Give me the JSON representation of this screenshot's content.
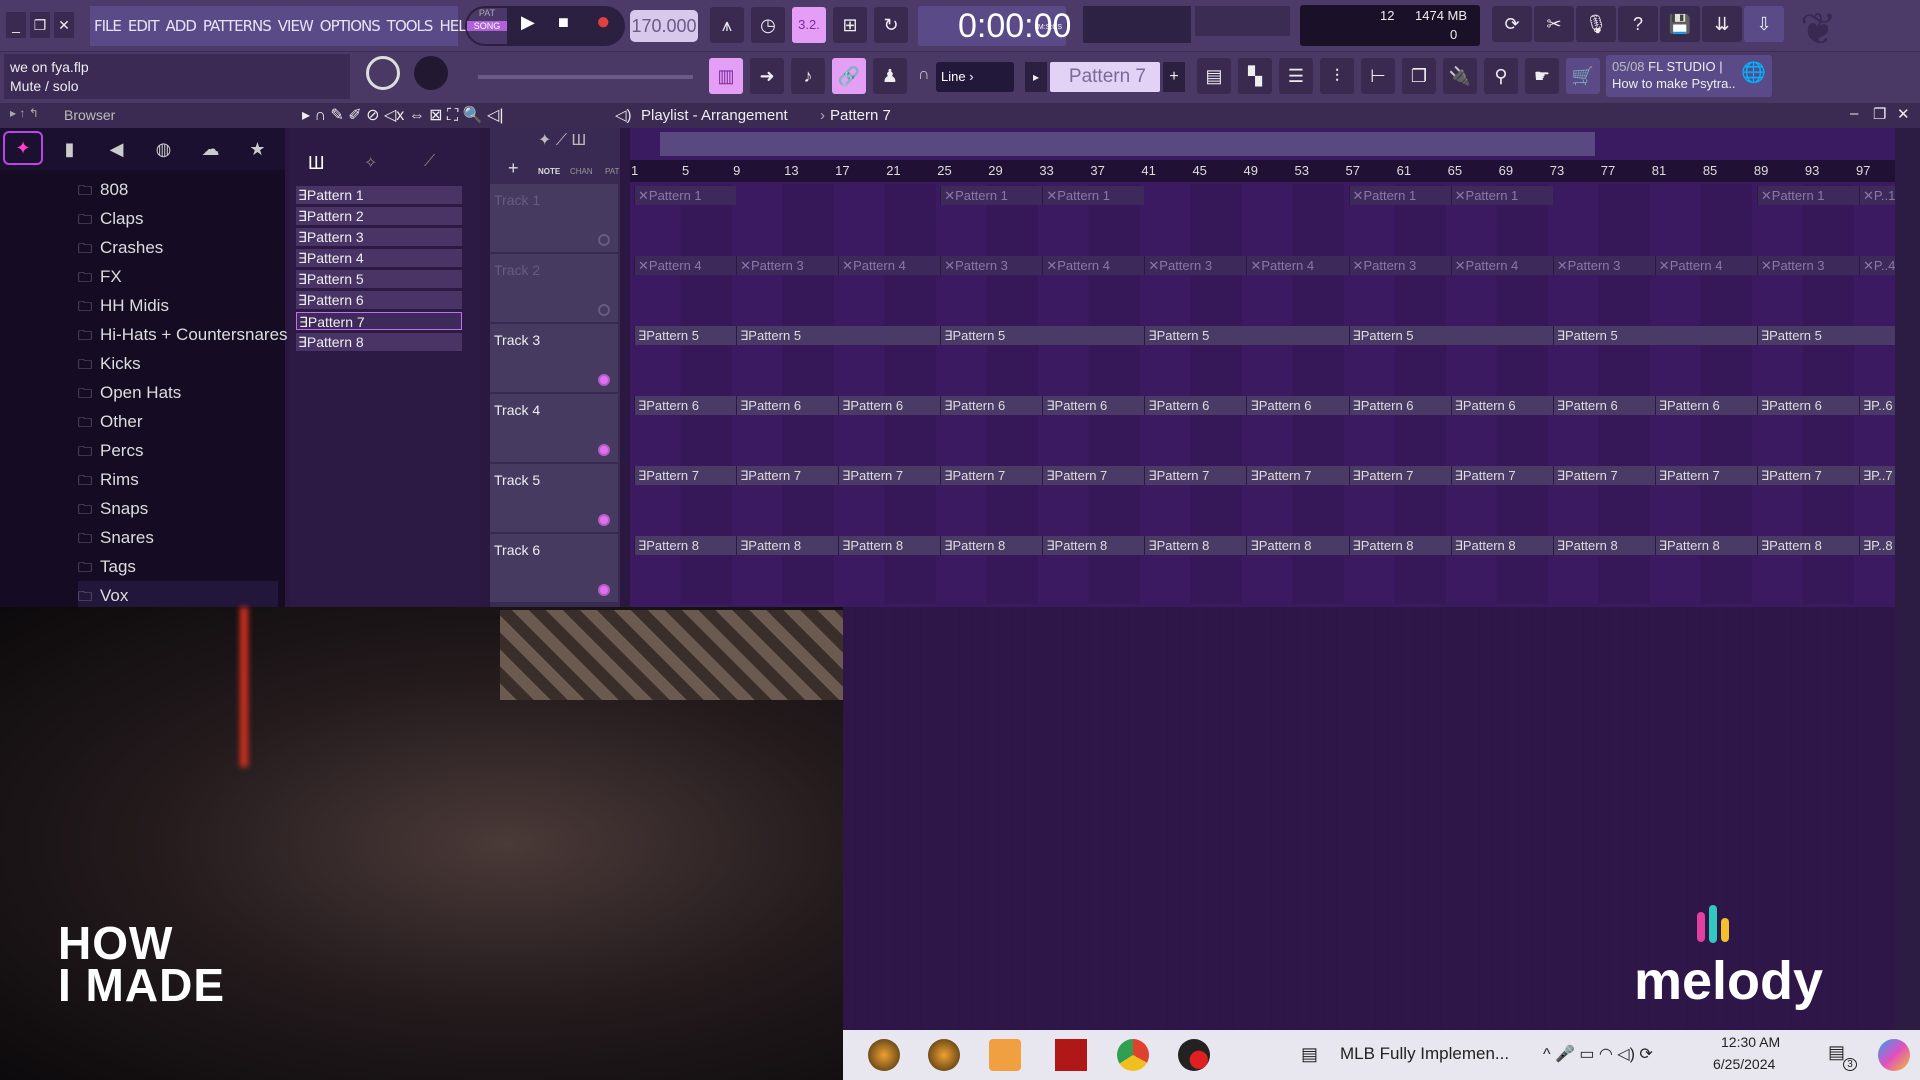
{
  "menu": {
    "items": [
      "FILE",
      "EDIT",
      "ADD",
      "PATTERNS",
      "VIEW",
      "OPTIONS",
      "TOOLS",
      "HELP"
    ]
  },
  "transport": {
    "pat": "PAT",
    "song": "SONG",
    "play": "▶",
    "stop": "■",
    "record": "●",
    "tempo": "170.000"
  },
  "time": {
    "value": "0:00:00",
    "format": "M:S:CS"
  },
  "cpu": {
    "voices": "12",
    "memory": "1474 MB",
    "poly": "0"
  },
  "hint": {
    "file": "we on fya.flp",
    "text": "Mute / solo"
  },
  "snap": {
    "value": "Line"
  },
  "pattern_selector": {
    "value": "Pattern 7"
  },
  "news": {
    "count": "05/08",
    "title": "FL STUDIO |",
    "subtitle": "How to make Psytra.."
  },
  "browser": {
    "title": "Browser",
    "folders": [
      "808",
      "Claps",
      "Crashes",
      "FX",
      "HH Midis",
      "Hi-Hats + Countersnares",
      "Kicks",
      "Open Hats",
      "Other",
      "Percs",
      "Rims",
      "Snaps",
      "Snares",
      "Tags",
      "Vox"
    ]
  },
  "playlist": {
    "title": "Playlist - Arrangement",
    "breadcrumb": "Pattern 7",
    "tabs": [
      "NOTE",
      "CHAN",
      "PAT"
    ]
  },
  "patterns": [
    "Pattern 1",
    "Pattern 2",
    "Pattern 3",
    "Pattern 4",
    "Pattern 5",
    "Pattern 6",
    "Pattern 7",
    "Pattern 8"
  ],
  "selected_pattern": "Pattern 7",
  "ruler": [
    "1",
    "5",
    "9",
    "13",
    "17",
    "21",
    "25",
    "29",
    "33",
    "37",
    "41",
    "45",
    "49",
    "53",
    "57",
    "61",
    "65",
    "69",
    "73",
    "77",
    "81",
    "85",
    "89",
    "93",
    "97"
  ],
  "tracks": [
    {
      "name": "Track 1",
      "muted": true,
      "clips": [
        [
          1,
          8,
          "Pattern 1"
        ],
        [
          25,
          8,
          "Pattern 1"
        ],
        [
          33,
          8,
          "Pattern 1"
        ],
        [
          57,
          8,
          "Pattern 1"
        ],
        [
          65,
          8,
          "Pattern 1"
        ],
        [
          89,
          8,
          "Pattern 1"
        ],
        [
          97,
          3,
          "P..1"
        ]
      ]
    },
    {
      "name": "Track 2",
      "muted": true,
      "clips": [
        [
          1,
          8,
          "Pattern 4"
        ],
        [
          9,
          8,
          "Pattern 3"
        ],
        [
          17,
          8,
          "Pattern 4"
        ],
        [
          25,
          8,
          "Pattern 3"
        ],
        [
          33,
          8,
          "Pattern 4"
        ],
        [
          41,
          8,
          "Pattern 3"
        ],
        [
          49,
          8,
          "Pattern 4"
        ],
        [
          57,
          8,
          "Pattern 3"
        ],
        [
          65,
          8,
          "Pattern 4"
        ],
        [
          73,
          8,
          "Pattern 3"
        ],
        [
          81,
          8,
          "Pattern 4"
        ],
        [
          89,
          8,
          "Pattern 3"
        ],
        [
          97,
          3,
          "P..4"
        ]
      ]
    },
    {
      "name": "Track 3",
      "muted": false,
      "clips": [
        [
          1,
          8,
          "Pattern 5"
        ],
        [
          9,
          16,
          "Pattern 5"
        ],
        [
          25,
          16,
          "Pattern 5"
        ],
        [
          41,
          16,
          "Pattern 5"
        ],
        [
          57,
          16,
          "Pattern 5"
        ],
        [
          73,
          16,
          "Pattern 5"
        ],
        [
          89,
          11,
          "Pattern 5"
        ]
      ]
    },
    {
      "name": "Track 4",
      "muted": false,
      "clips": [
        [
          1,
          8,
          "Pattern 6"
        ],
        [
          9,
          8,
          "Pattern 6"
        ],
        [
          17,
          8,
          "Pattern 6"
        ],
        [
          25,
          8,
          "Pattern 6"
        ],
        [
          33,
          8,
          "Pattern 6"
        ],
        [
          41,
          8,
          "Pattern 6"
        ],
        [
          49,
          8,
          "Pattern 6"
        ],
        [
          57,
          8,
          "Pattern 6"
        ],
        [
          65,
          8,
          "Pattern 6"
        ],
        [
          73,
          8,
          "Pattern 6"
        ],
        [
          81,
          8,
          "Pattern 6"
        ],
        [
          89,
          8,
          "Pattern 6"
        ],
        [
          97,
          3,
          "P..6"
        ]
      ]
    },
    {
      "name": "Track 5",
      "muted": false,
      "clips": [
        [
          1,
          8,
          "Pattern 7"
        ],
        [
          9,
          8,
          "Pattern 7"
        ],
        [
          17,
          8,
          "Pattern 7"
        ],
        [
          25,
          8,
          "Pattern 7"
        ],
        [
          33,
          8,
          "Pattern 7"
        ],
        [
          41,
          8,
          "Pattern 7"
        ],
        [
          49,
          8,
          "Pattern 7"
        ],
        [
          57,
          8,
          "Pattern 7"
        ],
        [
          65,
          8,
          "Pattern 7"
        ],
        [
          73,
          8,
          "Pattern 7"
        ],
        [
          81,
          8,
          "Pattern 7"
        ],
        [
          89,
          8,
          "Pattern 7"
        ],
        [
          97,
          3,
          "P..7"
        ]
      ]
    },
    {
      "name": "Track 6",
      "muted": false,
      "clips": [
        [
          1,
          8,
          "Pattern 8"
        ],
        [
          9,
          8,
          "Pattern 8"
        ],
        [
          17,
          8,
          "Pattern 8"
        ],
        [
          25,
          8,
          "Pattern 8"
        ],
        [
          33,
          8,
          "Pattern 8"
        ],
        [
          41,
          8,
          "Pattern 8"
        ],
        [
          49,
          8,
          "Pattern 8"
        ],
        [
          57,
          8,
          "Pattern 8"
        ],
        [
          65,
          8,
          "Pattern 8"
        ],
        [
          73,
          8,
          "Pattern 8"
        ],
        [
          81,
          8,
          "Pattern 8"
        ],
        [
          89,
          8,
          "Pattern 8"
        ],
        [
          97,
          3,
          "P..8"
        ]
      ]
    }
  ],
  "overlay": {
    "show_logo": "HOW I MADE",
    "brand_logo": "melody"
  },
  "taskbar": {
    "news": "MLB Fully Implemen...",
    "time": "12:30 AM",
    "date": "6/25/2024",
    "notifications": "3"
  },
  "colors": {
    "accent": "#e59ef5",
    "clip": "#4a3a66",
    "timeline": "#3a1a60"
  }
}
